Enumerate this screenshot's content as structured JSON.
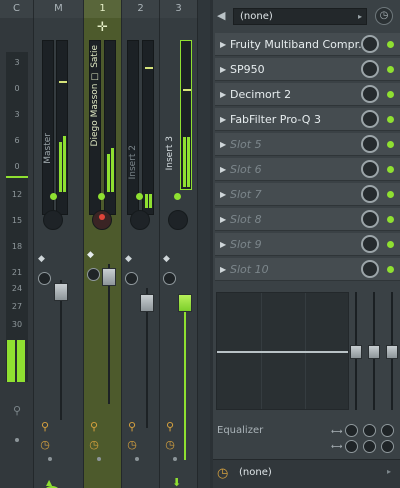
{
  "mixer": {
    "headers": [
      "C",
      "M",
      "1",
      "2",
      "3"
    ],
    "scale": [
      "3",
      "0",
      "3",
      "6",
      "0",
      "12",
      "15",
      "18",
      "21",
      "24",
      "27",
      "30"
    ],
    "tracks": [
      {
        "label": "Master"
      },
      {
        "label": "Diego Masson ☐ Satie"
      },
      {
        "label": "Insert 2"
      },
      {
        "label": "Insert 3"
      }
    ],
    "selected_insert_icon": "✛"
  },
  "rack": {
    "preset": "(none)",
    "slots": [
      {
        "name": "Fruity Multiband Compr..."
      },
      {
        "name": "SP950"
      },
      {
        "name": "Decimort 2"
      },
      {
        "name": "FabFilter Pro-Q 3"
      },
      {
        "name": "Slot 5"
      },
      {
        "name": "Slot 6"
      },
      {
        "name": "Slot 7"
      },
      {
        "name": "Slot 8"
      },
      {
        "name": "Slot 9"
      },
      {
        "name": "Slot 10"
      }
    ],
    "eq_label": "Equalizer",
    "output": "(none)"
  },
  "colors": {
    "accent": "#8fe031",
    "selected_strip": "#4d5a2c",
    "link_icon": "#d6a13e"
  }
}
